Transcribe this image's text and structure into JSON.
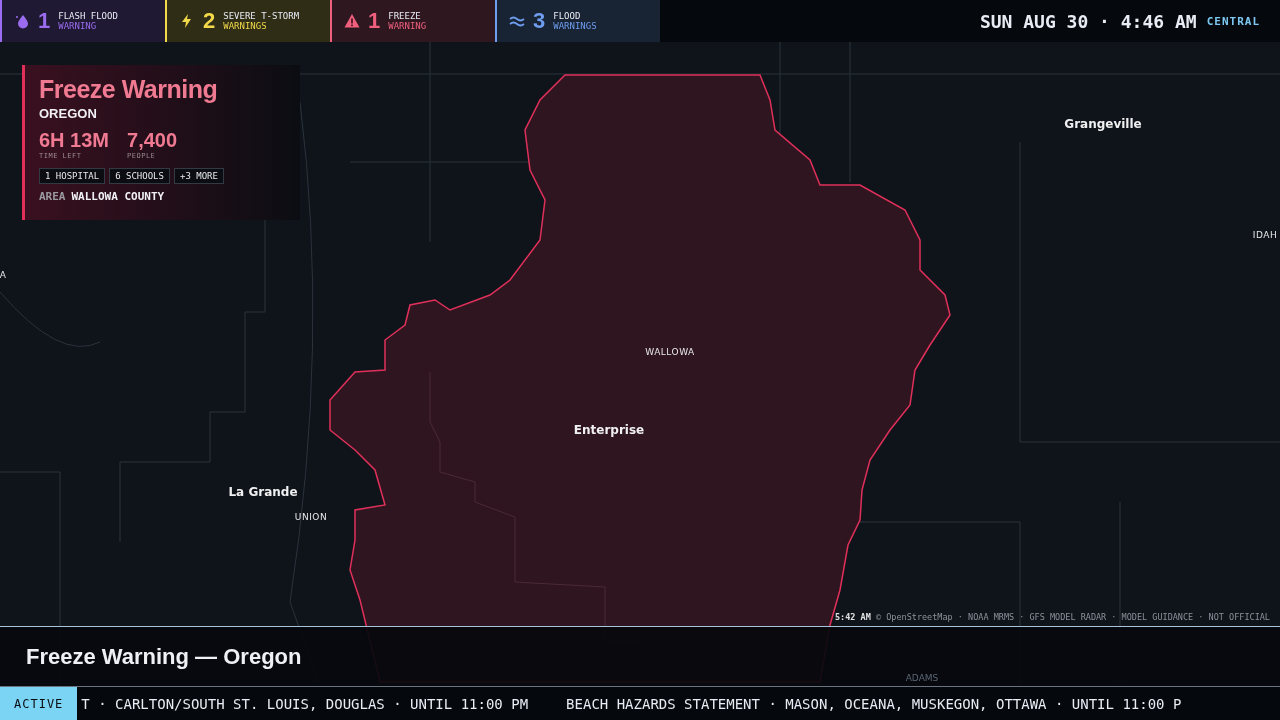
{
  "alerts": [
    {
      "kind": "flash_flood",
      "count": "1",
      "line1": "FLASH FLOOD",
      "line2": "WARNING",
      "color": "#9b6cf0"
    },
    {
      "kind": "tstorm",
      "count": "2",
      "line1": "SEVERE T-STORM",
      "line2": "WARNINGS",
      "color": "#f2d94a"
    },
    {
      "kind": "freeze",
      "count": "1",
      "line1": "FREEZE",
      "line2": "WARNING",
      "color": "#f0607e"
    },
    {
      "kind": "flood",
      "count": "3",
      "line1": "FLOOD",
      "line2": "WARNINGS",
      "color": "#6f9ef0"
    }
  ],
  "clock": {
    "datetime": "SUN AUG 30 · 4:46 AM",
    "zone": "CENTRAL"
  },
  "card": {
    "title": "Freeze Warning",
    "region": "OREGON",
    "stats": [
      {
        "value": "6H 13M",
        "label": "TIME LEFT"
      },
      {
        "value": "7,400",
        "label": "PEOPLE"
      }
    ],
    "tags": [
      "1 HOSPITAL",
      "6 SCHOOLS",
      "+3 MORE"
    ],
    "area_label": "AREA",
    "area": "WALLOWA COUNTY"
  },
  "map_labels": [
    {
      "kind": "city",
      "text": "Grangeville"
    },
    {
      "kind": "region",
      "text": "IDAH"
    },
    {
      "kind": "region",
      "text": "A"
    },
    {
      "kind": "region",
      "text": "WALLOWA"
    },
    {
      "kind": "city",
      "text": "Enterprise"
    },
    {
      "kind": "city",
      "text": "La Grande"
    },
    {
      "kind": "region",
      "text": "UNION"
    },
    {
      "kind": "faint",
      "text": "ADAMS"
    }
  ],
  "attribution": "**5:42 AM** © OpenStreetMap · NOAA MRMS · GFS MODEL RADAR · MODEL GUIDANCE · NOT OFFICIAL",
  "caption": "Freeze Warning — Oregon",
  "ticker": {
    "label": "ACTIVE",
    "items": [
      "T · CARLTON/SOUTH ST. LOUIS, DOUGLAS · UNTIL 11:00 PM",
      "BEACH HAZARDS STATEMENT · MASON, OCEANA, MUSKEGON, OTTAWA · UNTIL 11:00 P"
    ]
  }
}
